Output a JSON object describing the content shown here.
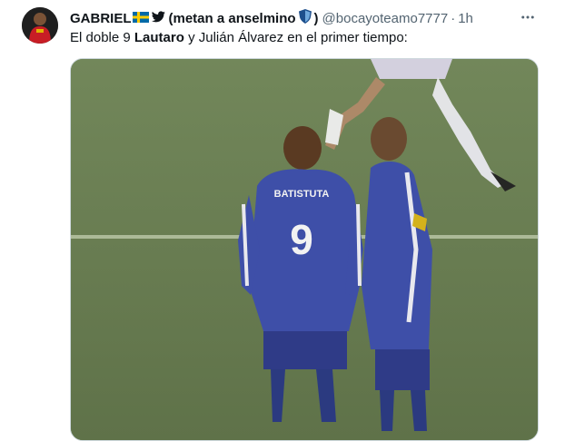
{
  "author": {
    "display_name": "GABRIEL",
    "flag_emoji": "🇸🇪",
    "name_suffix": "(metan a anselmino",
    "name_close": ")",
    "handle": "@bocayoteamo7777",
    "separator": "·",
    "time": "1h"
  },
  "tweet": {
    "text_part1": "El doble 9 ",
    "text_bold": "Lautaro",
    "text_part2": " y Julián Álvarez en el primer tiempo:"
  },
  "media": {
    "player_back_name": "BATISTUTA",
    "player_back_number": "9"
  },
  "colors": {
    "text": "#0f1419",
    "secondary": "#536471",
    "kit_blue": "#3e4fa8",
    "pitch": "#6b7f55"
  },
  "icons": [
    "sweden-flag-icon",
    "bird-icon",
    "shield-icon",
    "more-icon"
  ]
}
